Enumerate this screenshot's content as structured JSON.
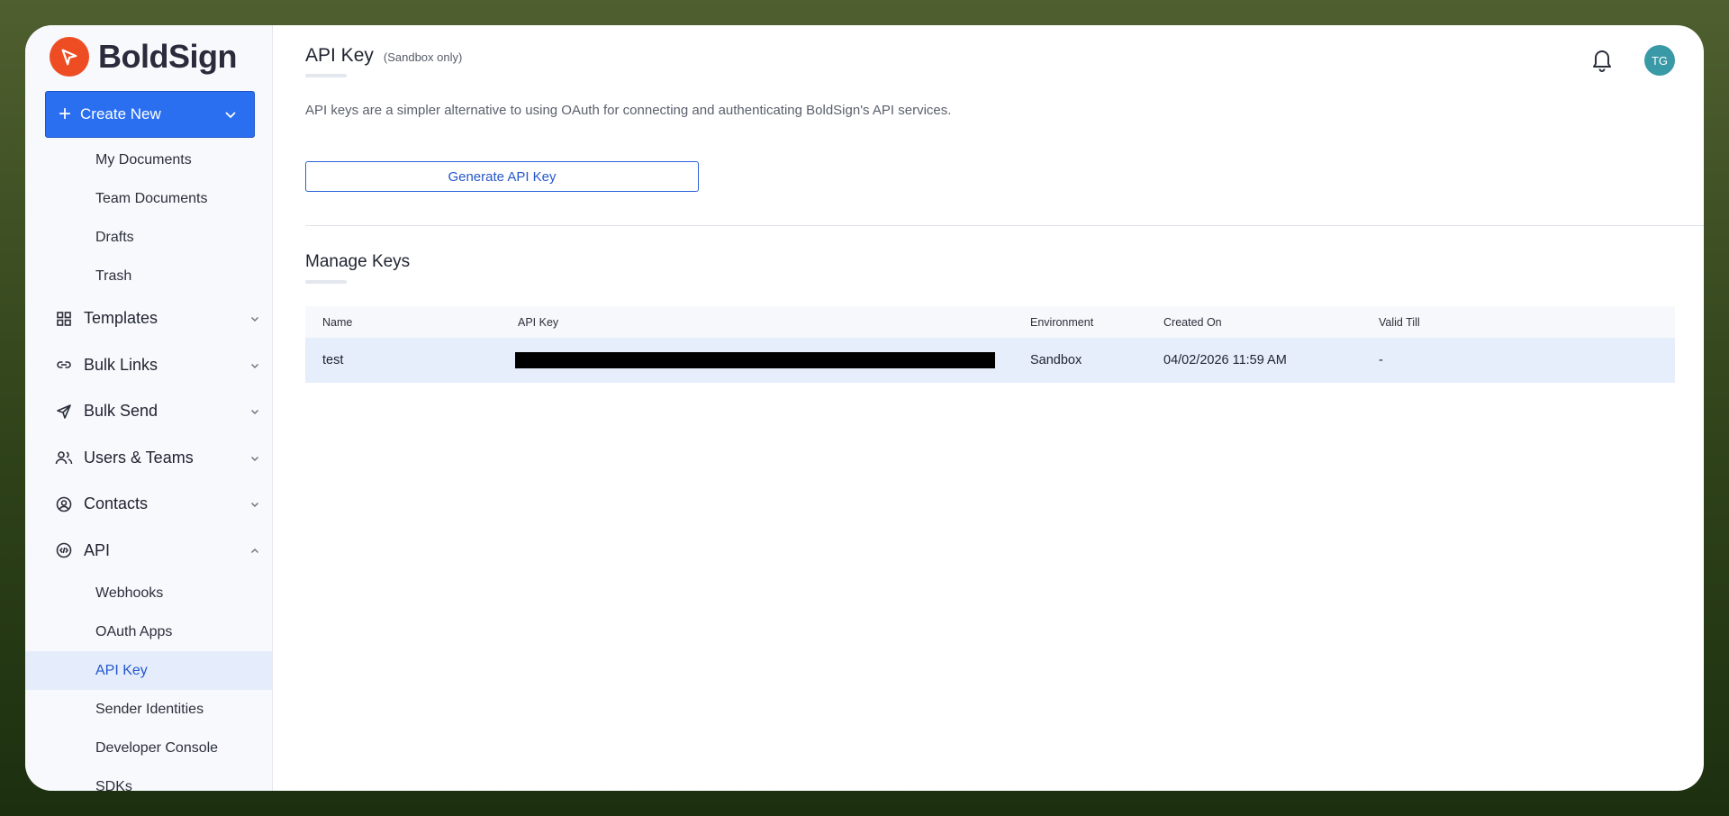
{
  "brand": {
    "name": "BoldSign",
    "logo_color": "#EE4D23"
  },
  "sidebar": {
    "create_new": "Create New",
    "doc_items": [
      {
        "label": "My Documents"
      },
      {
        "label": "Team Documents"
      },
      {
        "label": "Drafts"
      },
      {
        "label": "Trash"
      }
    ],
    "sections": [
      {
        "label": "Templates",
        "icon": "grid-icon"
      },
      {
        "label": "Bulk Links",
        "icon": "link-icon"
      },
      {
        "label": "Bulk Send",
        "icon": "send-icon"
      },
      {
        "label": "Users & Teams",
        "icon": "users-icon"
      },
      {
        "label": "Contacts",
        "icon": "contact-icon"
      },
      {
        "label": "API",
        "icon": "code-icon"
      }
    ],
    "api_items": [
      {
        "label": "Webhooks"
      },
      {
        "label": "OAuth Apps"
      },
      {
        "label": "API Key",
        "active": true
      },
      {
        "label": "Sender Identities"
      },
      {
        "label": "Developer Console"
      },
      {
        "label": "SDKs"
      }
    ]
  },
  "header": {
    "title": "API Key",
    "subtitle": "(Sandbox only)",
    "avatar_initials": "TG"
  },
  "main": {
    "description": "API keys are a simpler alternative to using OAuth for connecting and authenticating BoldSign's API services.",
    "generate_button": "Generate API Key",
    "manage_title": "Manage Keys",
    "table": {
      "columns": [
        "Name",
        "API Key",
        "Environment",
        "Created On",
        "Valid Till"
      ],
      "rows": [
        {
          "name": "test",
          "api_key": "",
          "environment": "Sandbox",
          "created_on": "04/02/2026 11:59 AM",
          "valid_till": "-"
        }
      ]
    }
  },
  "colors": {
    "accent": "#2A6FF0",
    "active_bg": "#E5ECFB",
    "avatar": "#3A99A6"
  }
}
